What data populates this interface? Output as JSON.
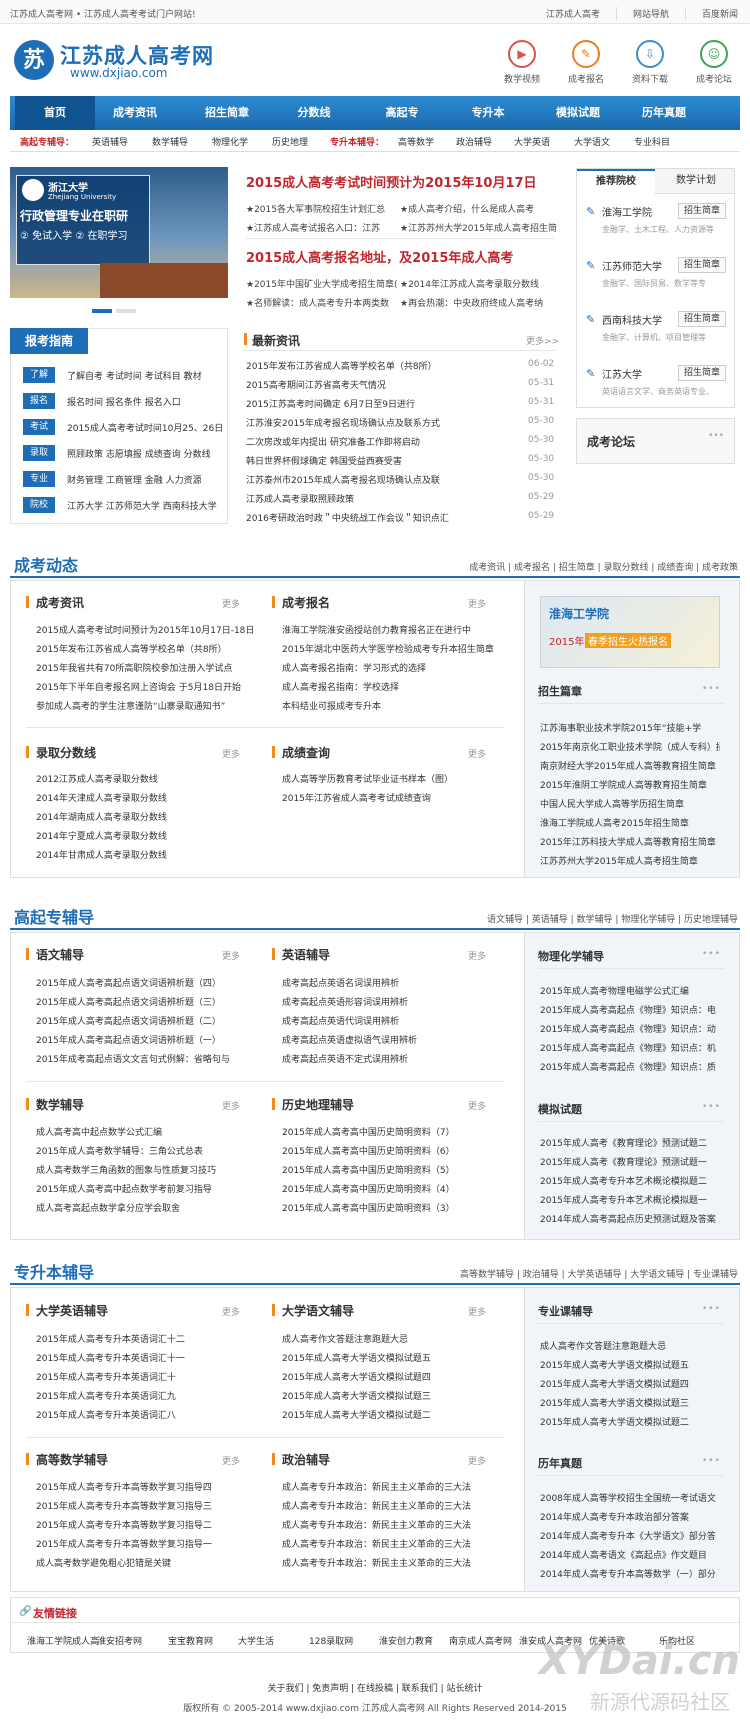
{
  "topbar": {
    "left": "江苏成人高考网 • 江苏成人高考考试门户网站!",
    "links": [
      "江苏成人高考",
      "网站导航",
      "百度新闻"
    ]
  },
  "logo": {
    "icon": "苏",
    "title": "江苏成人高考网",
    "url": "www.dxjiao.com"
  },
  "header_icons": [
    {
      "label": "教学视频",
      "icon": "video-icon",
      "color": "#d9534f"
    },
    {
      "label": "成考报名",
      "icon": "edit-icon",
      "color": "#e67e22"
    },
    {
      "label": "资料下载",
      "icon": "download-icon",
      "color": "#3a8fd0"
    },
    {
      "label": "成考论坛",
      "icon": "user-icon",
      "color": "#3aa757"
    }
  ],
  "nav": [
    "首页",
    "成考资讯",
    "招生简章",
    "分数线",
    "高起专",
    "专升本",
    "模拟试题",
    "历年真题"
  ],
  "subnav": {
    "g1_label": "高起专辅导：",
    "g1": [
      "英语辅导",
      "数学辅导",
      "物理化学",
      "历史地理"
    ],
    "g2_label": "专升本辅导：",
    "g2": [
      "高等数学",
      "政治辅导",
      "大学英语",
      "大学语文",
      "专业科目"
    ]
  },
  "banner": {
    "school": "浙江大学",
    "school_en": "Zhejiang University",
    "line1": "行政管理专业在职研",
    "line2": "② 免试入学 ② 在职学习"
  },
  "headline1": "2015成人高考考试时间预计为2015年10月17日",
  "headline1_links": [
    "★2015各大军事院校招生计划汇总",
    "★成人高考介绍，什么是成人高考",
    "★江苏成人高考试报名入口：江苏",
    "★江苏苏州大学2015年成人高考招生简"
  ],
  "headline2": "2015成人高考报名地址，及2015年成人高考",
  "headline2_links": [
    "★2015年中国矿业大学成考招生简章(",
    "★2014年江苏成人高考录取分数线",
    "★名师解读：成人高考专升本两类数",
    "★再会热潮：中央政府终成人高考纳"
  ],
  "latest": {
    "title": "最新资讯",
    "more": "更多>>",
    "items": [
      {
        "t": "2015年发布江苏省成人高等学校名单（共8所）",
        "d": "06-02"
      },
      {
        "t": "2015高考期间江苏省高考天气情况",
        "d": "05-31"
      },
      {
        "t": "2015江苏高考时间确定 6月7日至9日进行",
        "d": "05-31"
      },
      {
        "t": "江苏淮安2015年成考报名现场确认点及联系方式",
        "d": "05-30"
      },
      {
        "t": "二次房改或年内提出 研究准备工作即将启动",
        "d": "05-30"
      },
      {
        "t": "韩日世界杯假球确定 韩国受益西赛受害",
        "d": "05-30"
      },
      {
        "t": "江苏泰州市2015年成人高考报名现场确认点及联",
        "d": "05-30"
      },
      {
        "t": "江苏成人高考录取照顾政策",
        "d": "05-29"
      },
      {
        "t": "2016考研政治时政＂中央统战工作会议＂知识点汇",
        "d": "05-29"
      }
    ]
  },
  "guide": {
    "title": "报考指南",
    "rows": [
      {
        "tag": "了解",
        "text": "了解自考  考试时间  考试科目  教材"
      },
      {
        "tag": "报名",
        "text": "报名时间  报名条件  报名入口"
      },
      {
        "tag": "考试",
        "text": "2015成人高考考试时间10月25、26日"
      },
      {
        "tag": "录取",
        "text": "照顾政策  志愿填报  成绩查询  分数线"
      },
      {
        "tag": "专业",
        "text": "财务管理  工商管理  金融  人力资源"
      },
      {
        "tag": "院校",
        "text": "江苏大学  江苏师范大学  西南科技大学"
      }
    ]
  },
  "colleges": {
    "tabs": [
      "推荐院校",
      "数学计划"
    ],
    "btn": "招生简章",
    "items": [
      {
        "name": "淮海工学院",
        "sub": "金融学、土木工程、人力资源等"
      },
      {
        "name": "江苏师范大学",
        "sub": "金融学、国际贸易、数学等专"
      },
      {
        "name": "西南科技大学",
        "sub": "金融学、计算机、项目管理等"
      },
      {
        "name": "江苏大学",
        "sub": "英语语言文学、商务英语专业、"
      }
    ]
  },
  "forum": {
    "title": "成考论坛"
  },
  "sec1": {
    "title": "成考动态",
    "links": "成考资讯 | 成考报名 | 招生简章 | 录取分数线 | 成绩查询 | 成考政策",
    "b1": {
      "t": "成考资讯",
      "items": [
        "2015成人高考考试时间预计为2015年10月17日-18日",
        "2015年发布江苏省成人高等学校名单（共8所）",
        "2015年我省共有70所高职院校参加注册入学试点",
        "2015年下半年自考报名网上咨询会 于5月18日开始",
        "参加成人高考的学生注意谨防“山寨录取通知书”"
      ]
    },
    "b2": {
      "t": "成考报名",
      "items": [
        "淮海工学院淮安函授站创力教育报名正在进行中",
        "2015年湖北中医药大学医学检验成考专升本招生简章",
        "成人高考报名指南：学习形式的选择",
        "成人高考报名指南：学校选择",
        "本科结业可报成考专升本"
      ]
    },
    "b3": {
      "t": "录取分数线",
      "items": [
        "2012江苏成人高考录取分数线",
        "2014年天津成人高考录取分数线",
        "2014年湖南成人高考录取分数线",
        "2014年宁夏成人高考录取分数线",
        "2014年甘肃成人高考录取分数线"
      ]
    },
    "b4": {
      "t": "成绩查询",
      "items": [
        "成人高等学历教育考试毕业证书样本（图）",
        "2015年江苏省成人高考考试成绩查询"
      ]
    },
    "ad": {
      "t1": "淮海工学院",
      "t2": "2015年",
      "t3": "春季招生火热报名"
    },
    "side": {
      "t": "招生篇章",
      "items": [
        "江苏海事职业技术学院2015年“技能+学",
        "2015年南京化工职业技术学院（成人专科）招",
        "南京财经大学2015年成人高等教育招生简章",
        "2015年淮阴工学院成人高等教育招生简章",
        "中国人民大学成人高等学历招生简章",
        "淮海工学院成人高考2015年招生简章",
        "2015年江苏科技大学成人高等教育招生简章（表",
        "江苏苏州大学2015年成人高考招生简章"
      ]
    }
  },
  "sec2": {
    "title": "高起专辅导",
    "links": "语文辅导 | 英语辅导 | 数学辅导 | 物理化学辅导 | 历史地理辅导",
    "b1": {
      "t": "语文辅导",
      "items": [
        "2015年成人高考高起点语文词语辨析题（四）",
        "2015年成人高考高起点语文词语辨析题（三）",
        "2015年成人高考高起点语文词语辨析题（二）",
        "2015年成人高考高起点语文词语辨析题（一）",
        "2015年成考高起点语文文言句式例解：省略句与"
      ]
    },
    "b2": {
      "t": "英语辅导",
      "items": [
        "成考高起点英语名词误用辨析",
        "成考高起点英语形容词误用辨析",
        "成考高起点英语代词误用辨析",
        "成考高起点英语虚拟语气误用辨析",
        "成考高起点英语不定式误用辨析"
      ]
    },
    "b3": {
      "t": "数学辅导",
      "items": [
        "成人高考高中起点数学公式汇编",
        "2015年成人高考数学辅导：三角公式总表",
        "成人高考数学三角函数的图象与性质复习技巧",
        "2015年成人高考高中起点数学考前复习指导",
        "成人高考高起点数学拿分应学会取舍"
      ]
    },
    "b4": {
      "t": "历史地理辅导",
      "items": [
        "2015年成人高考高中国历史简明资料（7）",
        "2015年成人高考高中国历史简明资料（6）",
        "2015年成人高考高中国历史简明资料（5）",
        "2015年成人高考高中国历史简明资料（4）",
        "2015年成人高考高中国历史简明资料（3）"
      ]
    },
    "s1": {
      "t": "物理化学辅导",
      "items": [
        "2015年成人高考物理电磁学公式汇编",
        "2015年成人高考高起点《物理》知识点：电",
        "2015年成人高考高起点《物理》知识点：动",
        "2015年成人高考高起点《物理》知识点：机",
        "2015年成人高考高起点《物理》知识点：质"
      ]
    },
    "s2": {
      "t": "模拟试题",
      "items": [
        "2015年成人高考《教育理论》预测试题二",
        "2015年成人高考《教育理论》预测试题一",
        "2015年成人高考专升本艺术概论模拟题二",
        "2015年成人高考专升本艺术概论模拟题一",
        "2014年成人高考高起点历史预测试题及答案"
      ]
    }
  },
  "sec3": {
    "title": "专升本辅导",
    "links": "高等数学辅导 | 政治辅导 | 大学英语辅导 | 大学语文辅导 | 专业课辅导",
    "b1": {
      "t": "大学英语辅导",
      "items": [
        "2015年成人高考专升本英语词汇十二",
        "2015年成人高考专升本英语词汇十一",
        "2015年成人高考专升本英语词汇十",
        "2015年成人高考专升本英语词汇九",
        "2015年成人高考专升本英语词汇八"
      ]
    },
    "b2": {
      "t": "大学语文辅导",
      "items": [
        "成人高考作文答题注意跑题大忌",
        "2015年成人高考大学语文模拟试题五",
        "2015年成人高考大学语文模拟试题四",
        "2015年成人高考大学语文模拟试题三",
        "2015年成人高考大学语文模拟试题二"
      ]
    },
    "b3": {
      "t": "高等数学辅导",
      "items": [
        "2015年成人高考专升本高等数学复习指导四",
        "2015年成人高考专升本高等数学复习指导三",
        "2015年成人高考专升本高等数学复习指导二",
        "2015年成人高考专升本高等数学复习指导一",
        "成人高考数学避免粗心犯错是关键"
      ]
    },
    "b4": {
      "t": "政治辅导",
      "items": [
        "成人高考专升本政治：新民主主义革命的三大法",
        "成人高考专升本政治：新民主主义革命的三大法",
        "成人高考专升本政治：新民主主义革命的三大法",
        "成人高考专升本政治：新民主主义革命的三大法",
        "成人高考专升本政治：新民主主义革命的三大法"
      ]
    },
    "s1": {
      "t": "专业课辅导",
      "items": [
        "成人高考作文答题注意跑题大忌",
        "2015年成人高考大学语文模拟试题五",
        "2015年成人高考大学语文模拟试题四",
        "2015年成人高考大学语文模拟试题三",
        "2015年成人高考大学语文模拟试题二"
      ]
    },
    "s2": {
      "t": "历年真题",
      "items": [
        "2008年成人高等学校招生全国统一考试语文",
        "2014年成人高考专升本政治部分答案",
        "2014年成人高考专升本《大学语文》部分答",
        "2014年成人高考语文《高起点》作文题目",
        "2014年成人高考专升本高等数学（一）部分"
      ]
    }
  },
  "more": "更多",
  "friends": {
    "title": "友情链接",
    "items": [
      "淮海工学院成人高",
      "淮安招考网",
      "宝宝教育网",
      "大学生活",
      "128录取网",
      "淮安创力教育",
      "南京成人高考网",
      "淮安成人高考网",
      "优美诗歌",
      "乐昀社区"
    ]
  },
  "footer": {
    "links": "关于我们 | 免责声明 | 在线投稿 | 联系我们 | 站长统计",
    "copy": "版权所有 © 2005-2014  www.dxjiao.com 江苏成人高考网  All Rights Reserved 2014-2015"
  },
  "watermark": {
    "t1": "XYDai.cn",
    "t2": "新源代源码社区"
  }
}
